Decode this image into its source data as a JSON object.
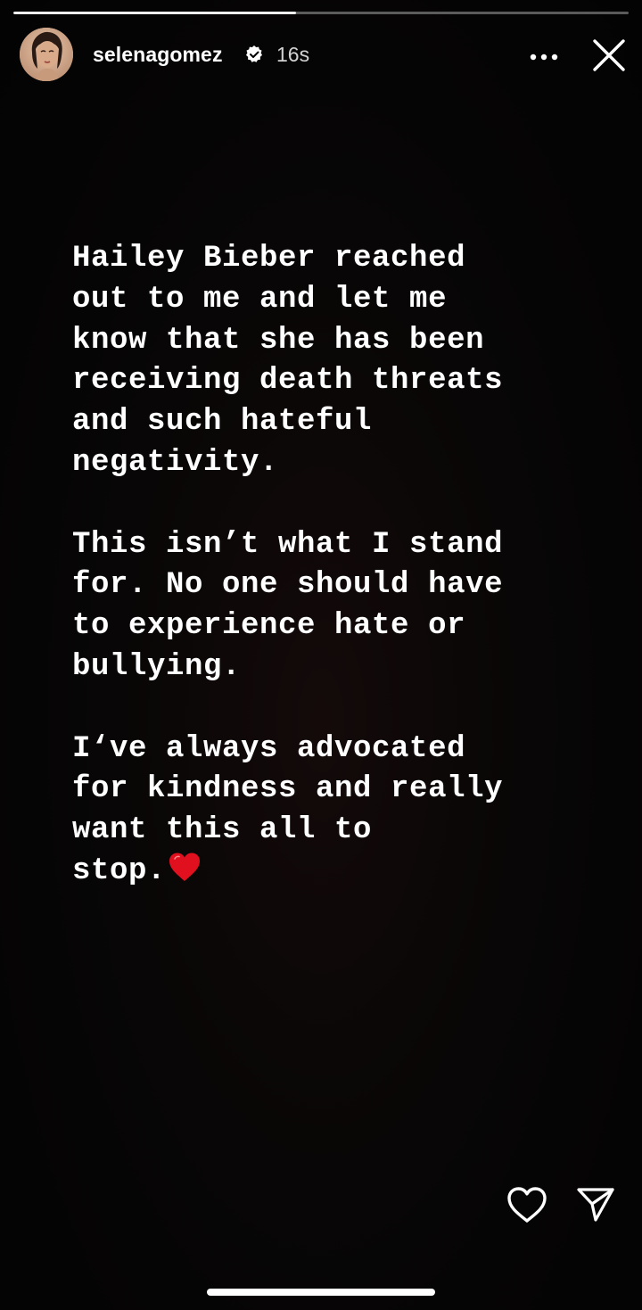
{
  "story": {
    "progress": 0.46,
    "username": "selenagomez",
    "verified": true,
    "timestamp": "16s",
    "paragraphs": [
      "Hailey Bieber reached\nout to me and let me\nknow that she has been\nreceiving death threats\nand such hateful\nnegativity.",
      "This isn’t what I stand\nfor. No one should have\nto experience hate or\nbullying.",
      "I‘ve always advocated\nfor kindness and really\nwant this all to\nstop."
    ]
  },
  "icons": {
    "verified": "verified-badge-icon",
    "more": "more-options-icon",
    "close": "close-icon",
    "heart_emoji": "red-heart-emoji",
    "like": "heart-outline-icon",
    "share": "paper-plane-icon"
  },
  "colors": {
    "background": "#000000",
    "text": "#ffffff",
    "heart_emoji": "#e0101e"
  }
}
